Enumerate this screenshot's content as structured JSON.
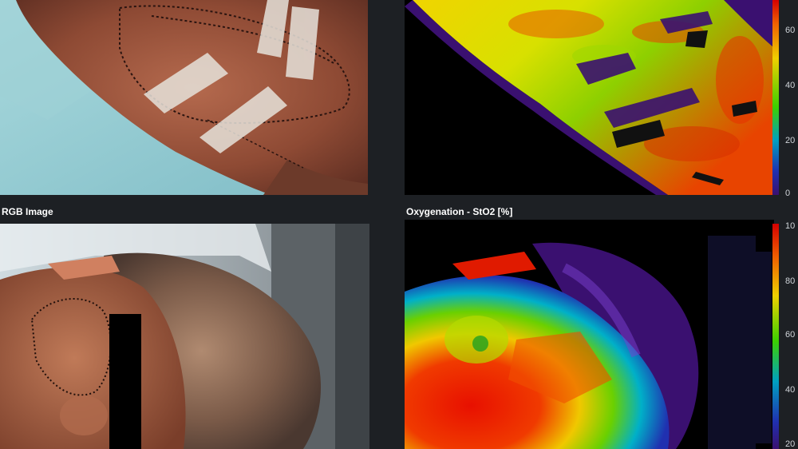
{
  "panels": {
    "top_left": {
      "label": ""
    },
    "top_right": {
      "label": ""
    },
    "bottom_left": {
      "label": "RGB Image"
    },
    "bottom_right": {
      "label": "Oxygenation - StO2 [%]"
    }
  },
  "scale_top": {
    "ticks": [
      "60",
      "40",
      "20",
      "0"
    ]
  },
  "scale_bottom": {
    "ticks": [
      "10",
      "80",
      "60",
      "40",
      "20"
    ]
  },
  "colors": {
    "background": "#1d2024",
    "scale_high": "#d40000",
    "scale_mid": "#3cd000",
    "scale_low": "#3a1070"
  }
}
